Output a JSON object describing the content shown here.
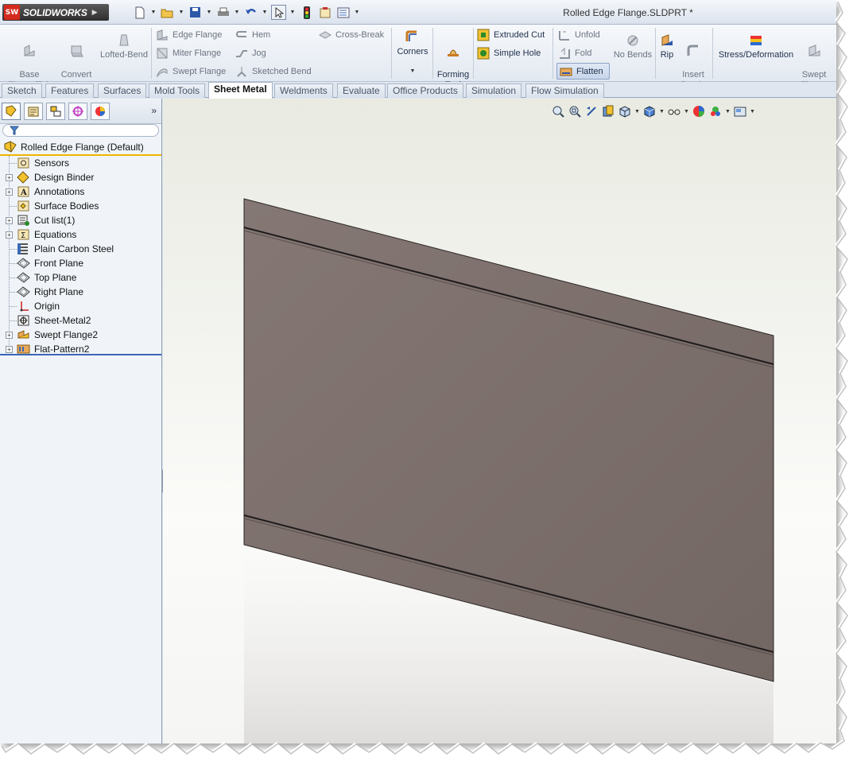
{
  "app": {
    "name": "SOLIDWORKS",
    "logo_mark": "SW",
    "document_title": "Rolled Edge Flange.SLDPRT *"
  },
  "quick_access": [
    {
      "icon": "new-document-icon"
    },
    {
      "icon": "open-folder-icon"
    },
    {
      "icon": "save-icon"
    },
    {
      "icon": "print-icon"
    },
    {
      "icon": "undo-icon"
    },
    {
      "icon": "select-arrow-icon"
    },
    {
      "icon": "rebuild-traffic-light-icon"
    },
    {
      "icon": "file-properties-icon"
    },
    {
      "icon": "options-icon"
    }
  ],
  "command_manager": {
    "base_flange": "Base\nFlange/Tab",
    "convert": "Convert\nto Sheet\nMetal",
    "lofted_bend": "Lofted-Bend",
    "edge_flange": "Edge Flange",
    "miter_flange": "Miter Flange",
    "swept_flange_small": "Swept Flange",
    "hem": "Hem",
    "jog": "Jog",
    "sketched_bend": "Sketched Bend",
    "cross_break": "Cross-Break",
    "corners": "Corners",
    "forming_tool": "Forming\nTool",
    "extruded_cut": "Extruded Cut",
    "simple_hole": "Simple Hole",
    "unfold": "Unfold",
    "fold": "Fold",
    "flatten": "Flatten",
    "no_bends": "No Bends",
    "rip": "Rip",
    "insert_bends": "Insert\nBends",
    "stress_deformation": "Stress/Deformation",
    "swept_flange_large": "Swept\nFlange"
  },
  "tabs": [
    "Sketch",
    "Features",
    "Surfaces",
    "Mold Tools",
    "Sheet Metal",
    "Weldments",
    "Evaluate",
    "Office Products",
    "Simulation",
    "Flow Simulation"
  ],
  "active_tab": "Sheet Metal",
  "feature_tree": {
    "root": "Rolled Edge Flange  (Default)",
    "items": [
      {
        "label": "Sensors",
        "icon": "sensors-icon",
        "expandable": false
      },
      {
        "label": "Design Binder",
        "icon": "design-binder-icon",
        "expandable": true
      },
      {
        "label": "Annotations",
        "icon": "annotations-icon",
        "expandable": true
      },
      {
        "label": "Surface Bodies",
        "icon": "surface-bodies-icon",
        "expandable": false
      },
      {
        "label": "Cut list(1)",
        "icon": "cut-list-icon",
        "expandable": true
      },
      {
        "label": "Equations",
        "icon": "equations-icon",
        "expandable": true
      },
      {
        "label": "Plain Carbon Steel",
        "icon": "material-icon",
        "expandable": false
      },
      {
        "label": "Front Plane",
        "icon": "plane-icon",
        "expandable": false
      },
      {
        "label": "Top Plane",
        "icon": "plane-icon",
        "expandable": false
      },
      {
        "label": "Right Plane",
        "icon": "plane-icon",
        "expandable": false
      },
      {
        "label": "Origin",
        "icon": "origin-icon",
        "expandable": false
      },
      {
        "label": "Sheet-Metal2",
        "icon": "sheet-metal-icon",
        "expandable": false
      },
      {
        "label": "Swept Flange2",
        "icon": "swept-flange-icon",
        "expandable": true
      },
      {
        "label": "Flat-Pattern2",
        "icon": "flat-pattern-icon",
        "expandable": true
      }
    ]
  },
  "panel_tabs": [
    "feature-manager-icon",
    "property-manager-icon",
    "configuration-manager-icon",
    "dimxpert-icon",
    "display-manager-icon"
  ],
  "heads_up": [
    "zoom-to-fit-icon",
    "zoom-to-area-icon",
    "previous-view-icon",
    "section-view-icon",
    "view-orientation-icon",
    "display-style-icon",
    "hide-show-icon",
    "edit-appearance-icon",
    "apply-scene-icon",
    "view-settings-icon"
  ],
  "colors": {
    "model_face": "#7a6e6a",
    "model_edge": "#1f1c1c",
    "highlight": "#f0b400"
  }
}
